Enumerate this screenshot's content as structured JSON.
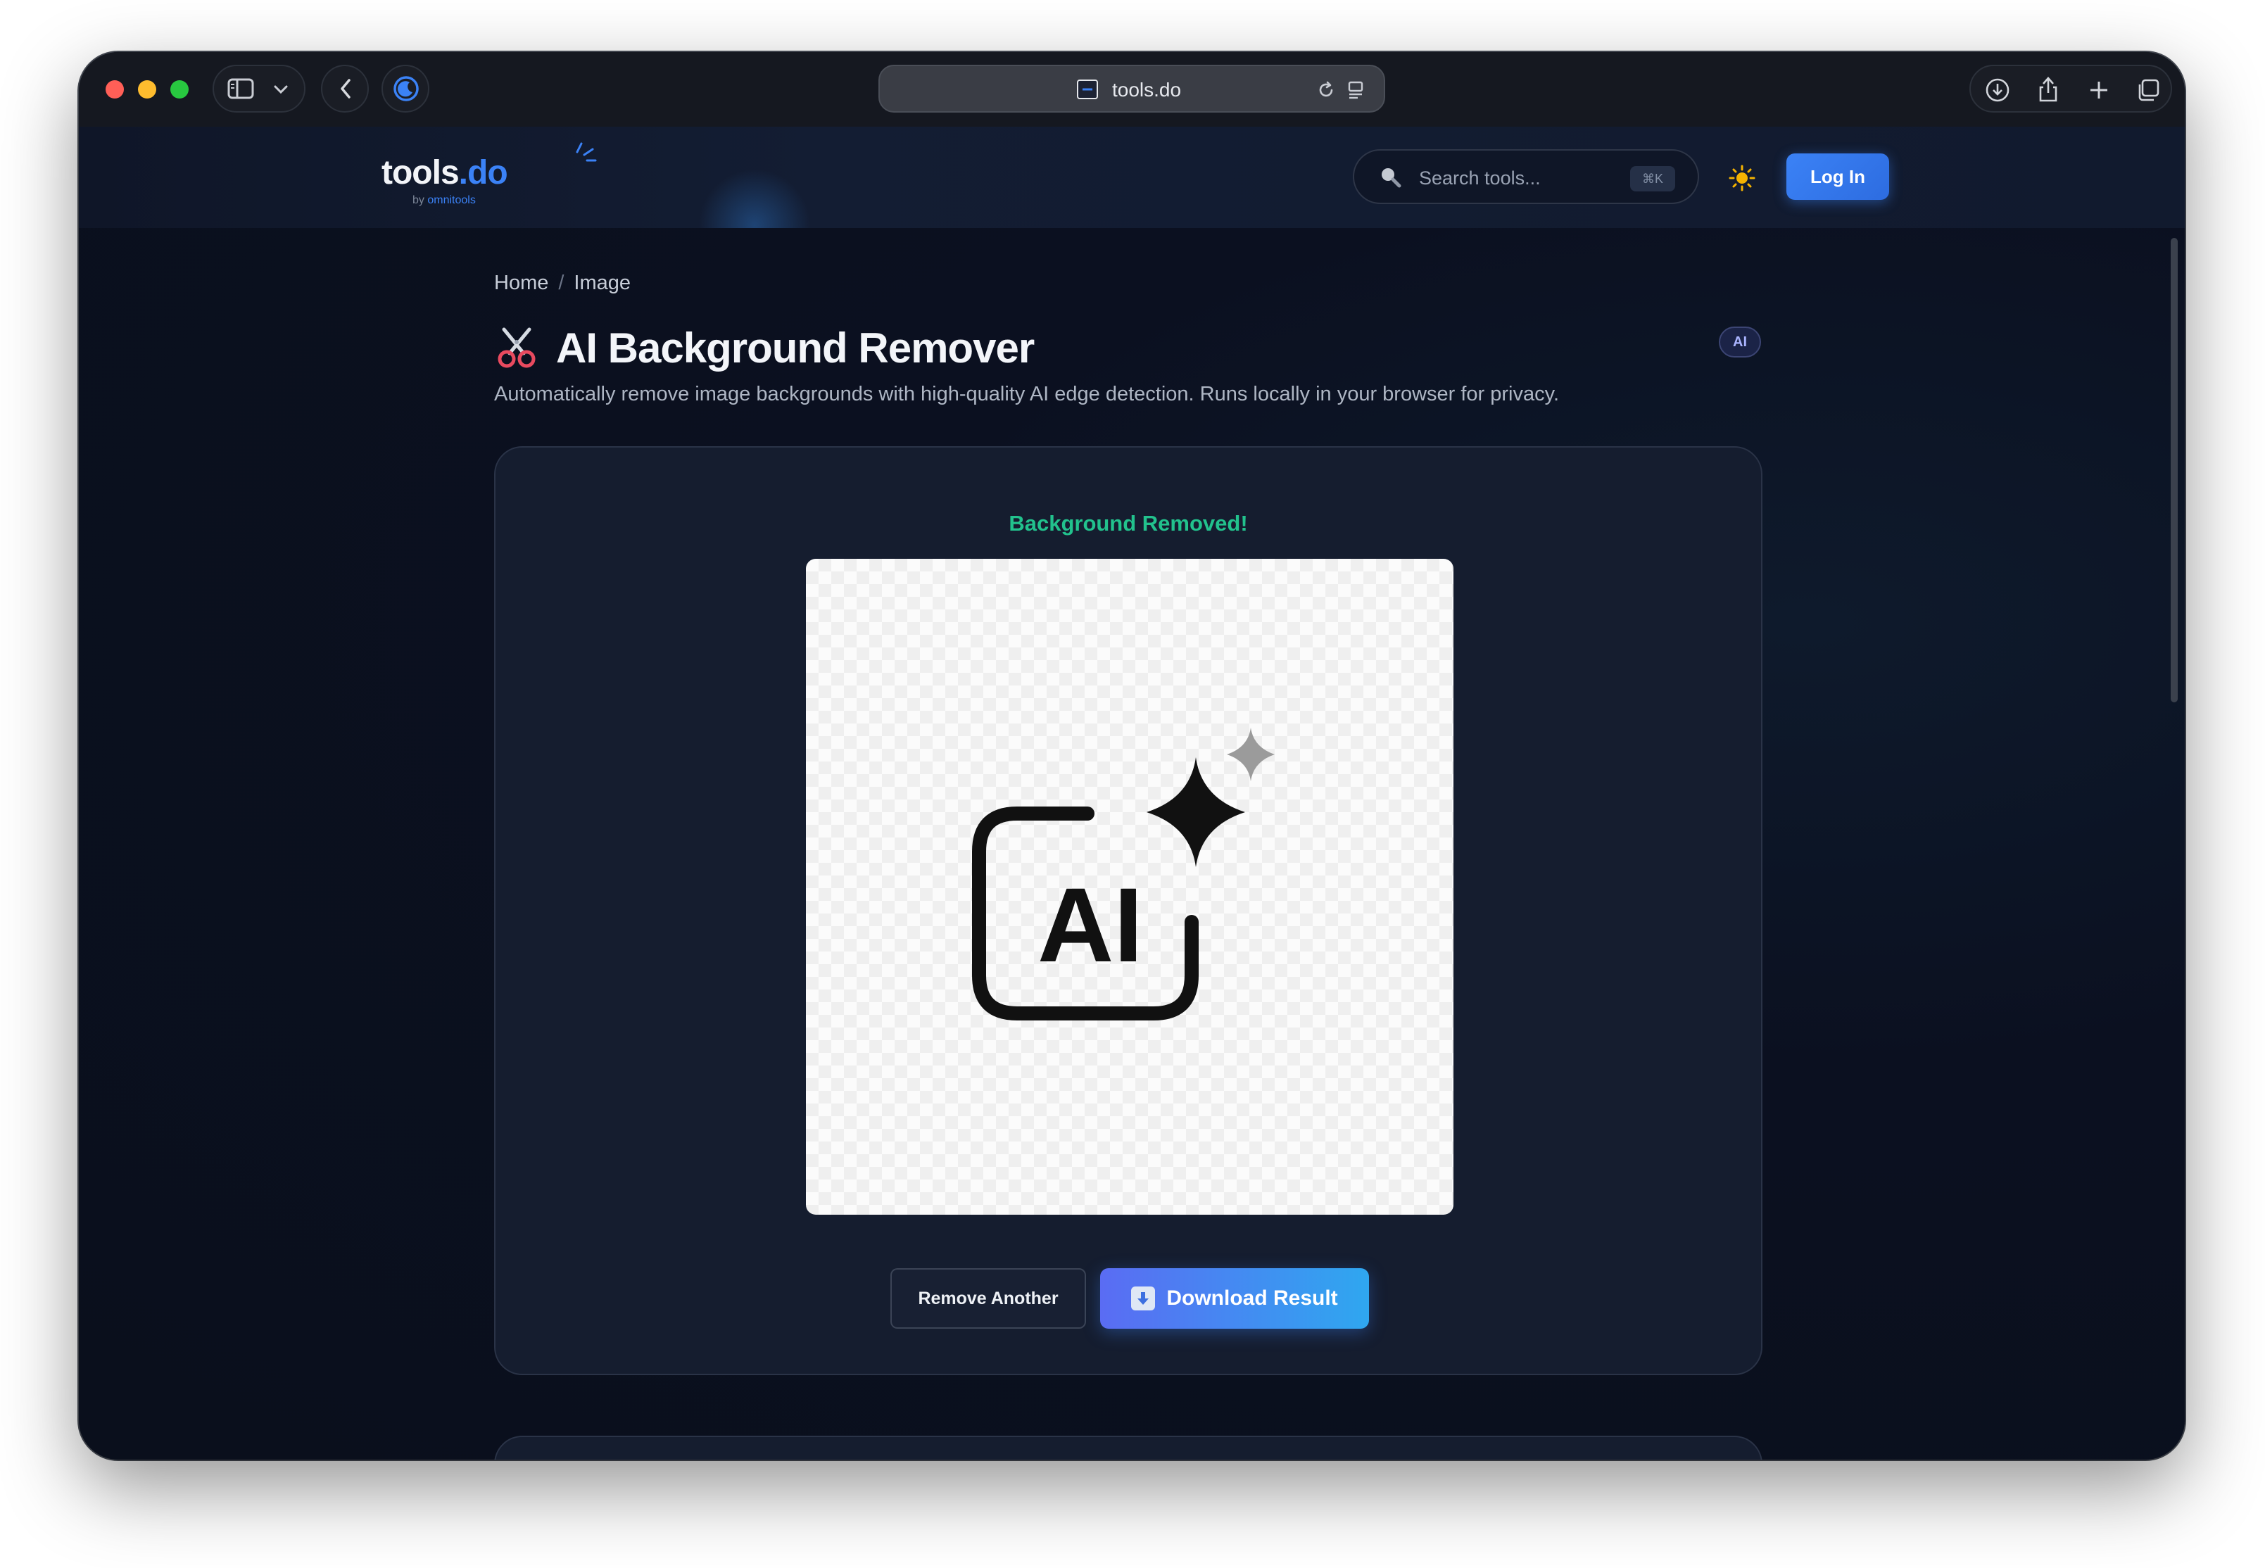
{
  "browser": {
    "url": "tools.do"
  },
  "site": {
    "logo": {
      "main": "tools",
      "accent": ".do",
      "by": "by",
      "brand": "omnitools"
    },
    "search": {
      "placeholder": "Search tools...",
      "shortcut": "⌘K"
    },
    "login_label": "Log In"
  },
  "breadcrumb": {
    "home": "Home",
    "separator": "/",
    "current": "Image"
  },
  "page": {
    "title": "AI Background Remover",
    "badge": "AI",
    "description": "Automatically remove image backgrounds with high-quality AI edge detection. Runs locally in your browser for privacy."
  },
  "result": {
    "status": "Background Removed!",
    "image_text": "AI",
    "remove_another_label": "Remove Another",
    "download_label": "Download Result"
  },
  "colors": {
    "accent": "#3b82f6",
    "success": "#22c28d",
    "background": "#0b1020"
  }
}
